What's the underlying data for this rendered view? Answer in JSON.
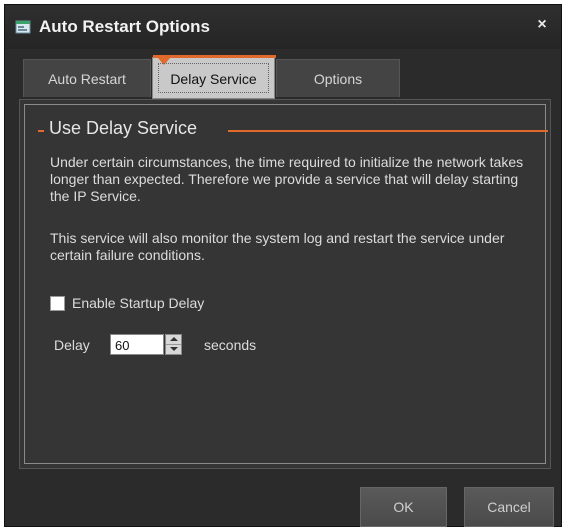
{
  "window": {
    "title": "Auto Restart Options",
    "close_glyph": "×"
  },
  "tabs": [
    {
      "label": "Auto Restart",
      "active": false
    },
    {
      "label": "Delay Service",
      "active": true
    },
    {
      "label": "Options",
      "active": false
    }
  ],
  "panel": {
    "group_title": "Use Delay Service",
    "paragraph1": "Under certain circumstances, the time required to initialize the network takes longer than expected. Therefore we provide a service that will delay starting the IP Service.",
    "paragraph2": "This service will also monitor the system log and restart the service under certain failure conditions.",
    "checkbox": {
      "label": "Enable Startup Delay",
      "checked": false
    },
    "delay": {
      "label": "Delay",
      "value": "60",
      "unit": "seconds"
    }
  },
  "buttons": {
    "ok": "OK",
    "cancel": "Cancel"
  },
  "colors": {
    "accent": "#e0692b",
    "background": "#2b2b2b",
    "panel": "#353535"
  },
  "icons": {
    "app": "app-window-icon",
    "close": "close-icon"
  }
}
